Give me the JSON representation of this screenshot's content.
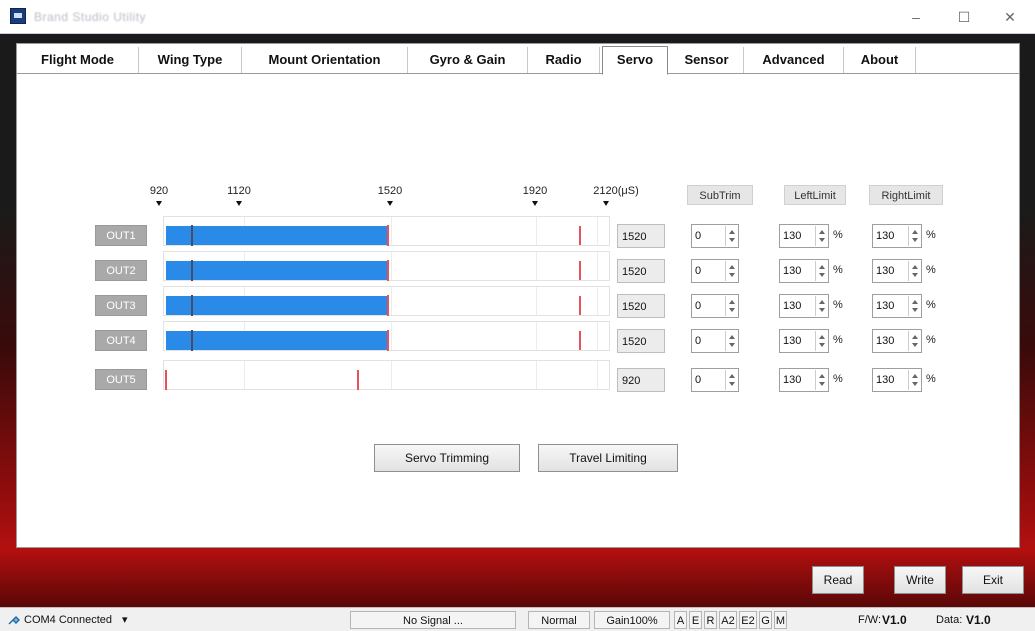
{
  "window": {
    "title": "Brand Studio Utility",
    "minimize": "–",
    "maximize": "☐",
    "close": "✕"
  },
  "tabs": [
    {
      "label": "Flight Mode"
    },
    {
      "label": "Wing Type"
    },
    {
      "label": "Mount Orientation"
    },
    {
      "label": "Gyro & Gain"
    },
    {
      "label": "Radio"
    },
    {
      "label": "Servo",
      "active": true
    },
    {
      "label": "Sensor"
    },
    {
      "label": "Advanced"
    },
    {
      "label": "About"
    }
  ],
  "scale": {
    "ticks": [
      "920",
      "1120",
      "1520",
      "1920",
      "2120(μS)"
    ]
  },
  "columns": {
    "subtrim": "SubTrim",
    "left_limit": "LeftLimit",
    "right_limit": "RightLimit"
  },
  "outputs": [
    {
      "label": "OUT1",
      "value": "1520",
      "subtrim": "0",
      "left": "130",
      "right": "130",
      "pulse_us": 1520
    },
    {
      "label": "OUT2",
      "value": "1520",
      "subtrim": "0",
      "left": "130",
      "right": "130",
      "pulse_us": 1520
    },
    {
      "label": "OUT3",
      "value": "1520",
      "subtrim": "0",
      "left": "130",
      "right": "130",
      "pulse_us": 1520
    },
    {
      "label": "OUT4",
      "value": "1520",
      "subtrim": "0",
      "left": "130",
      "right": "130",
      "pulse_us": 1520
    },
    {
      "label": "OUT5",
      "value": "920",
      "subtrim": "0",
      "left": "130",
      "right": "130",
      "pulse_us": 920
    }
  ],
  "percent_sign": "%",
  "actions": {
    "servo_trimming": "Servo Trimming",
    "travel_limiting": "Travel Limiting"
  },
  "footer_buttons": {
    "read": "Read",
    "write": "Write",
    "exit": "Exit"
  },
  "statusbar": {
    "connection": "COM4 Connected",
    "signal": "No Signal ...",
    "mode": "Normal",
    "gain": "Gain100%",
    "channels": [
      "A",
      "E",
      "R",
      "A2",
      "E2",
      "G",
      "M"
    ],
    "fw_label": "F/W:",
    "fw_value": "V1.0",
    "data_label": "Data:",
    "data_value": "V1.0"
  },
  "colors": {
    "bar": "#2a8ae8",
    "marker": "#e8505a",
    "frame_red": "#b31010"
  }
}
